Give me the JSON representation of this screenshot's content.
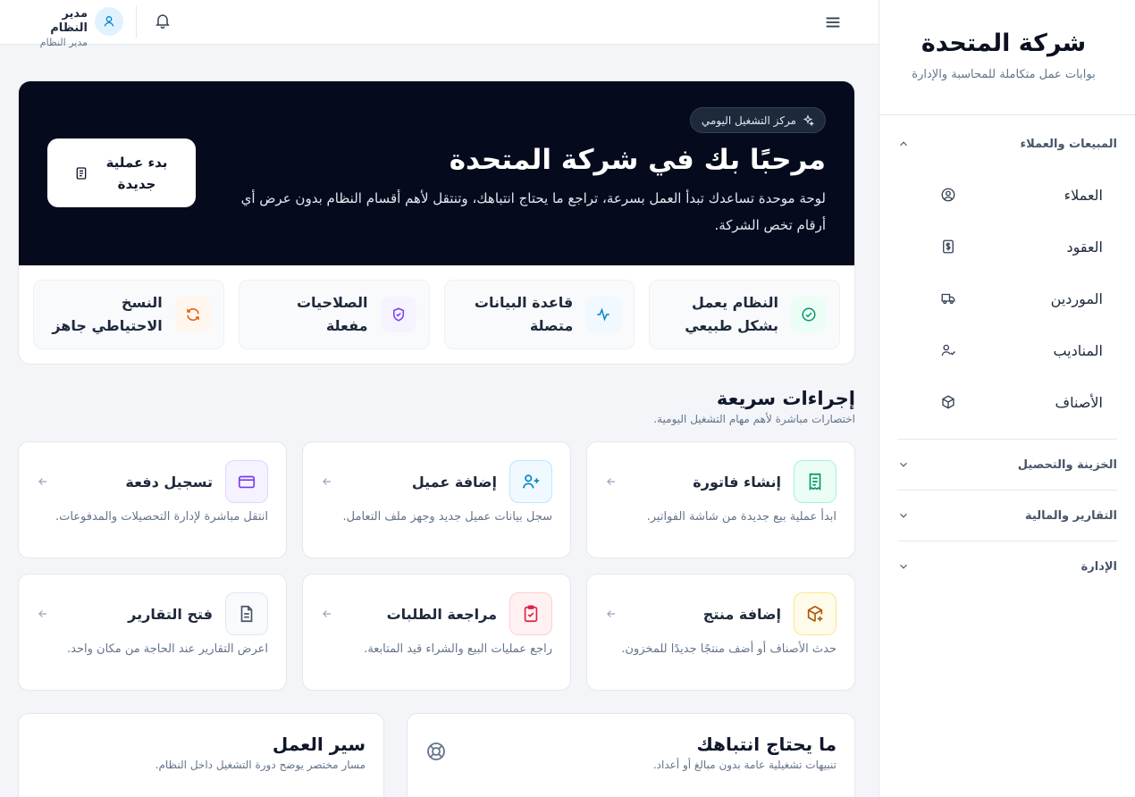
{
  "sidebar": {
    "company": "شركة المتحدة",
    "tagline": "بوابات عمل متكاملة للمحاسبة والإدارة",
    "groups": [
      {
        "label": "المبيعات والعملاء",
        "expanded": true,
        "items": [
          {
            "label": "العملاء",
            "icon": "user-circle-icon"
          },
          {
            "label": "العقود",
            "icon": "dollar-file-icon"
          },
          {
            "label": "الموردين",
            "icon": "truck-icon"
          },
          {
            "label": "المناديب",
            "icon": "user-check-icon"
          },
          {
            "label": "الأصناف",
            "icon": "box-icon"
          }
        ]
      },
      {
        "label": "الخزينة والتحصيل",
        "expanded": false
      },
      {
        "label": "التقارير والمالية",
        "expanded": false
      },
      {
        "label": "الإدارة",
        "expanded": false
      }
    ]
  },
  "topbar": {
    "user_name": "مدير النظام",
    "user_role": "مدير النظام"
  },
  "hero": {
    "pill": "مركز التشغيل اليومي",
    "title": "مرحبًا بك في شركة المتحدة",
    "description": "لوحة موحدة تساعدك تبدأ العمل بسرعة، تراجع ما يحتاج انتباهك، وتنتقل لأهم أقسام النظام بدون عرض أي أرقام تخص الشركة.",
    "button_label": "بدء عملية جديدة"
  },
  "status": [
    {
      "label": "النظام يعمل بشكل طبيعي",
      "icon": "check-circle-icon",
      "color": "#059669",
      "bg": "#ecfdf5"
    },
    {
      "label": "قاعدة البيانات متصلة",
      "icon": "activity-icon",
      "color": "#0284c7",
      "bg": "#f0f9ff"
    },
    {
      "label": "الصلاحيات مفعلة",
      "icon": "shield-icon",
      "color": "#7c3aed",
      "bg": "#f5f3ff"
    },
    {
      "label": "النسخ الاحتياطي جاهز",
      "icon": "refresh-icon",
      "color": "#ea580c",
      "bg": "#fff7ed"
    }
  ],
  "quick_actions": {
    "title": "إجراءات سريعة",
    "subtitle": "اختصارات مباشرة لأهم مهام التشغيل اليومية.",
    "items": [
      {
        "title": "إنشاء فاتورة",
        "desc": "ابدأ عملية بيع جديدة من شاشة الفواتير.",
        "icon": "receipt-icon",
        "color": "#059669",
        "bg": "#ecfdf5",
        "border": "#a7f3d0"
      },
      {
        "title": "إضافة عميل",
        "desc": "سجل بيانات عميل جديد وجهز ملف التعامل.",
        "icon": "user-plus-icon",
        "color": "#0284c7",
        "bg": "#f0f9ff",
        "border": "#bae6fd"
      },
      {
        "title": "تسجيل دفعة",
        "desc": "انتقل مباشرة لإدارة التحصيلات والمدفوعات.",
        "icon": "credit-card-icon",
        "color": "#7c3aed",
        "bg": "#f5f3ff",
        "border": "#ddd6fe"
      },
      {
        "title": "إضافة منتج",
        "desc": "حدث الأصناف أو أضف منتجًا جديدًا للمخزون.",
        "icon": "package-plus-icon",
        "color": "#b45309",
        "bg": "#fffbeb",
        "border": "#fde68a"
      },
      {
        "title": "مراجعة الطلبات",
        "desc": "راجع عمليات البيع والشراء قيد المتابعة.",
        "icon": "clipboard-check-icon",
        "color": "#e11d48",
        "bg": "#fff1f2",
        "border": "#fecdd3"
      },
      {
        "title": "فتح التقارير",
        "desc": "اعرض التقارير عند الحاجة من مكان واحد.",
        "icon": "file-text-icon",
        "color": "#475569",
        "bg": "#f8fafc",
        "border": "#e2e8f0"
      }
    ]
  },
  "attention": {
    "title": "ما يحتاج انتباهك",
    "subtitle": "تنبيهات تشغيلية عامة بدون مبالغ أو أعداد."
  },
  "workflow": {
    "title": "سير العمل",
    "subtitle": "مسار مختصر يوضح دورة التشغيل داخل النظام."
  }
}
